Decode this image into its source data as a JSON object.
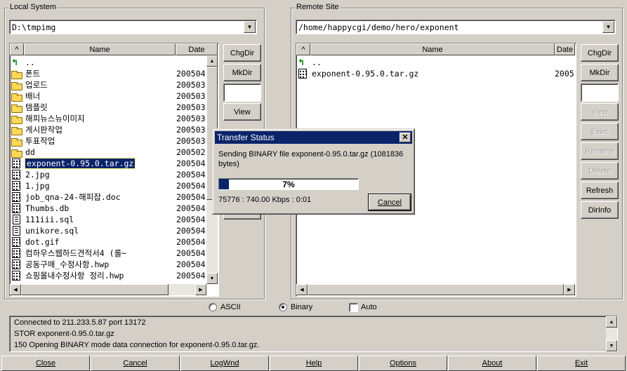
{
  "local": {
    "group_label": "Local System",
    "path": "D:\\tmpimg",
    "columns": {
      "sort": "^",
      "name": "Name",
      "date": "Date"
    },
    "rows": [
      {
        "icon": "up-arrow-icon",
        "name": "..",
        "date": ""
      },
      {
        "icon": "folder-icon",
        "name": "폰트",
        "date": "200504"
      },
      {
        "icon": "folder-icon",
        "name": "업로드",
        "date": "200503"
      },
      {
        "icon": "folder-icon",
        "name": "배너",
        "date": "200503"
      },
      {
        "icon": "folder-icon",
        "name": "템플릿",
        "date": "200503"
      },
      {
        "icon": "folder-icon",
        "name": "해피뉴스뉴이미지",
        "date": "200503"
      },
      {
        "icon": "folder-icon",
        "name": "게시판작업",
        "date": "200503"
      },
      {
        "icon": "folder-icon",
        "name": "투표작업",
        "date": "200503"
      },
      {
        "icon": "folder-icon",
        "name": "dd",
        "date": "200502"
      },
      {
        "icon": "binary-file-icon",
        "name": "exponent-0.95.0.tar.gz",
        "date": "200504",
        "selected": true
      },
      {
        "icon": "binary-file-icon",
        "name": "2.jpg",
        "date": "200504"
      },
      {
        "icon": "binary-file-icon",
        "name": "1.jpg",
        "date": "200504"
      },
      {
        "icon": "binary-file-icon",
        "name": "job_qna-24-해피잡.doc",
        "date": "200504"
      },
      {
        "icon": "binary-file-icon",
        "name": "Thumbs.db",
        "date": "200504"
      },
      {
        "icon": "text-file-icon",
        "name": "111iii.sql",
        "date": "200504"
      },
      {
        "icon": "text-file-icon",
        "name": "unikore.sql",
        "date": "200504"
      },
      {
        "icon": "binary-file-icon",
        "name": "dot.gif",
        "date": "200504"
      },
      {
        "icon": "binary-file-icon",
        "name": "컴하우스웹하드견적서4 (롤~",
        "date": "200504"
      },
      {
        "icon": "binary-file-icon",
        "name": "공동구매_수정사항.hwp",
        "date": "200504"
      },
      {
        "icon": "binary-file-icon",
        "name": "쇼핑몰내수정사항 정리.hwp",
        "date": "200504"
      }
    ],
    "buttons": {
      "chgdir": "ChgDir",
      "mkdir": "MkDir",
      "view": "View"
    }
  },
  "remote": {
    "group_label": "Remote Site",
    "path": "/home/happycgi/demo/hero/exponent",
    "columns": {
      "sort": "^",
      "name": "Name",
      "date": "Date"
    },
    "rows": [
      {
        "icon": "up-arrow-icon",
        "name": "..",
        "date": ""
      },
      {
        "icon": "binary-file-icon",
        "name": "exponent-0.95.0.tar.gz",
        "date": "2005"
      }
    ],
    "buttons": {
      "chgdir": "ChgDir",
      "mkdir": "MkDir",
      "view": "View",
      "exec": "Exec",
      "rename": "Rename",
      "delete": "Delete",
      "refresh": "Refresh",
      "dirinfo": "DirInfo"
    }
  },
  "transfer_mode": {
    "ascii": "ASCII",
    "binary": "Binary",
    "auto": "Auto",
    "selected": "Binary",
    "auto_checked": false
  },
  "log": [
    "Connected to 211.233.5.87 port 13172",
    "STOR exponent-0.95.0.tar.gz",
    "150 Opening BINARY mode data connection for exponent-0.95.0.tar.gz."
  ],
  "dialog": {
    "title": "Transfer Status",
    "message": "Sending BINARY file exponent-0.95.0.tar.gz (1081836 bytes)",
    "progress_percent": 7,
    "progress_label": "7%",
    "stats": "75776 : 740.00 Kbps : 0:01",
    "cancel": "Cancel"
  },
  "bottom_buttons": [
    "Close",
    "Cancel",
    "LogWnd",
    "Help",
    "Options",
    "About",
    "Exit"
  ]
}
